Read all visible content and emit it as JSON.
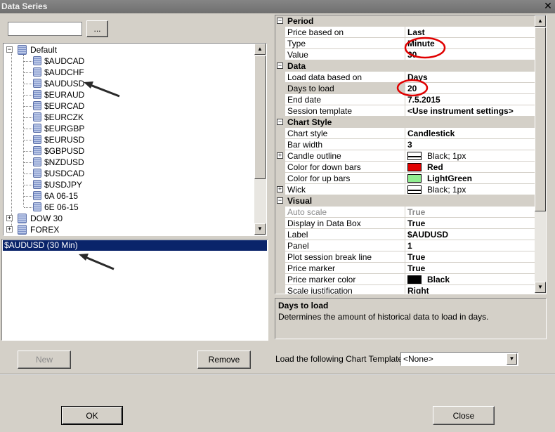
{
  "window": {
    "title": "Data Series",
    "close_glyph": "✕"
  },
  "search": {
    "value": "",
    "browse_label": "..."
  },
  "tree": {
    "items": [
      {
        "label": "Default",
        "expander": "−"
      },
      {
        "label": "$AUDCAD"
      },
      {
        "label": "$AUDCHF"
      },
      {
        "label": "$AUDUSD"
      },
      {
        "label": "$EURAUD"
      },
      {
        "label": "$EURCAD"
      },
      {
        "label": "$EURCZK"
      },
      {
        "label": "$EURGBP"
      },
      {
        "label": "$EURUSD"
      },
      {
        "label": "$GBPUSD"
      },
      {
        "label": "$NZDUSD"
      },
      {
        "label": "$USDCAD"
      },
      {
        "label": "$USDJPY"
      },
      {
        "label": "6A 06-15"
      },
      {
        "label": "6E 06-15"
      },
      {
        "label": "DOW 30",
        "expander": "+"
      },
      {
        "label": "FOREX",
        "expander": "+"
      }
    ]
  },
  "series_list": {
    "selected": "$AUDUSD (30 Min)"
  },
  "buttons": {
    "new": "New",
    "remove": "Remove",
    "ok": "OK",
    "close": "Close"
  },
  "grid": {
    "period": {
      "category": "Period",
      "price_based_on": "Price based on",
      "price_based_on_value": "Last",
      "type": "Type",
      "type_value": "Minute",
      "value": "Value",
      "value_value": "30"
    },
    "data": {
      "category": "Data",
      "load_based_on": "Load data based on",
      "load_based_on_value": "Days",
      "days_to_load": "Days to load",
      "days_to_load_value": "20",
      "end_date": "End date",
      "end_date_value": "7.5.2015",
      "session_template": "Session template",
      "session_template_value": "<Use instrument settings>"
    },
    "chart_style": {
      "category": "Chart Style",
      "chart_style": "Chart style",
      "chart_style_value": "Candlestick",
      "bar_width": "Bar width",
      "bar_width_value": "3",
      "candle_outline": "Candle outline",
      "candle_outline_value": "Black; 1px",
      "down_bars": "Color for down bars",
      "down_bars_value": "Red",
      "down_color": "#e00000",
      "up_bars": "Color for up bars",
      "up_bars_value": "LightGreen",
      "up_color": "#90ee90",
      "wick": "Wick",
      "wick_value": "Black; 1px"
    },
    "visual": {
      "category": "Visual",
      "auto_scale": "Auto scale",
      "auto_scale_value": "True",
      "display_data_box": "Display in Data Box",
      "display_data_box_value": "True",
      "label": "Label",
      "label_value": "$AUDUSD",
      "panel": "Panel",
      "panel_value": "1",
      "plot_session": "Plot session break line",
      "plot_session_value": "True",
      "price_marker": "Price marker",
      "price_marker_value": "True",
      "price_marker_color": "Price marker color",
      "price_marker_color_value": "Black",
      "scale_justification": "Scale justification",
      "scale_justification_value": "Right"
    }
  },
  "description": {
    "title": "Days to load",
    "text": "Determines the amount of historical data to load in days."
  },
  "chart_template": {
    "label": "Load the following Chart Template:",
    "value": "<None>"
  },
  "colors": {
    "annotation_red": "#e00000",
    "selection": "#0a246a"
  }
}
